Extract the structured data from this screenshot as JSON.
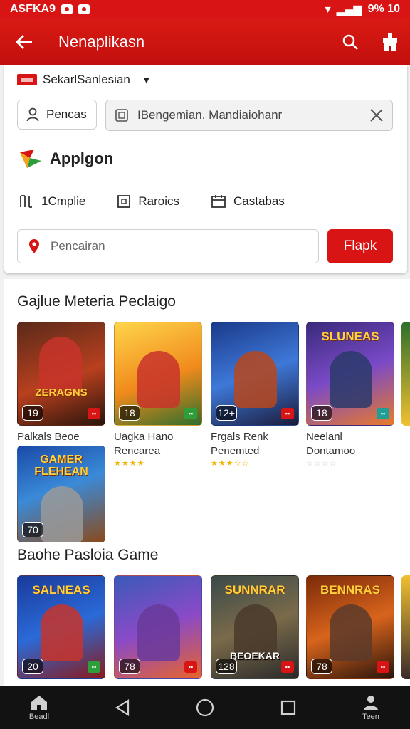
{
  "status_bar": {
    "left_text": "ASFKA9",
    "right_text": "9% 10"
  },
  "app_bar": {
    "title": "Nenaplikasn"
  },
  "location": {
    "label": "SekarlSanlesian"
  },
  "chip": {
    "label": "Pencas"
  },
  "top_search": {
    "value": "IBengemian. Mandiaiohanr"
  },
  "brand": {
    "name": "Applgon"
  },
  "filters": [
    {
      "label": "1Cmplie"
    },
    {
      "label": "Raroics"
    },
    {
      "label": "Castabas"
    }
  ],
  "search": {
    "placeholder": "Pencairan",
    "button_label": "Flapk"
  },
  "sections": [
    {
      "title": "Gajlue Meteria Peclaigo",
      "items": [
        {
          "name_line1": "Palkals Beoe",
          "name_line2": "",
          "rating": "19",
          "logo": "ZERAGNS",
          "stars": "",
          "badge": "red"
        },
        {
          "name_line1": "Uagka Hano",
          "name_line2": "Rencarea",
          "rating": "18",
          "logo": "",
          "stars": "★★★★",
          "badge": "green"
        },
        {
          "name_line1": "Frgals Renk",
          "name_line2": "Penemted",
          "rating": "12+",
          "logo": "",
          "stars": "★★★☆☆",
          "badge": "red"
        },
        {
          "name_line1": "Neelanl",
          "name_line2": "Dontamoo",
          "rating": "18",
          "logo": "SLUNEAS",
          "stars": "☆☆☆☆",
          "badge": "teal"
        },
        {
          "name_line1": "",
          "name_line2": "",
          "rating": "70",
          "logo": "GAMER FLEHEAN",
          "stars": "",
          "badge": ""
        }
      ]
    },
    {
      "title": "Baohe Pasloia Game",
      "items": [
        {
          "rating": "20",
          "logo": "SALNEAS",
          "badge": "green"
        },
        {
          "rating": "78",
          "logo": "",
          "badge": "red"
        },
        {
          "rating": "128",
          "logo": "SUNNRAR",
          "badge": "red",
          "bottom_text": "BEOEKAR"
        },
        {
          "rating": "78",
          "logo": "BENNRAS",
          "badge": "red"
        }
      ]
    }
  ],
  "nav": {
    "home_label": "Beadl",
    "profile_label": "Teen"
  },
  "colors": {
    "primary": "#d81414",
    "navbar": "#121212"
  }
}
